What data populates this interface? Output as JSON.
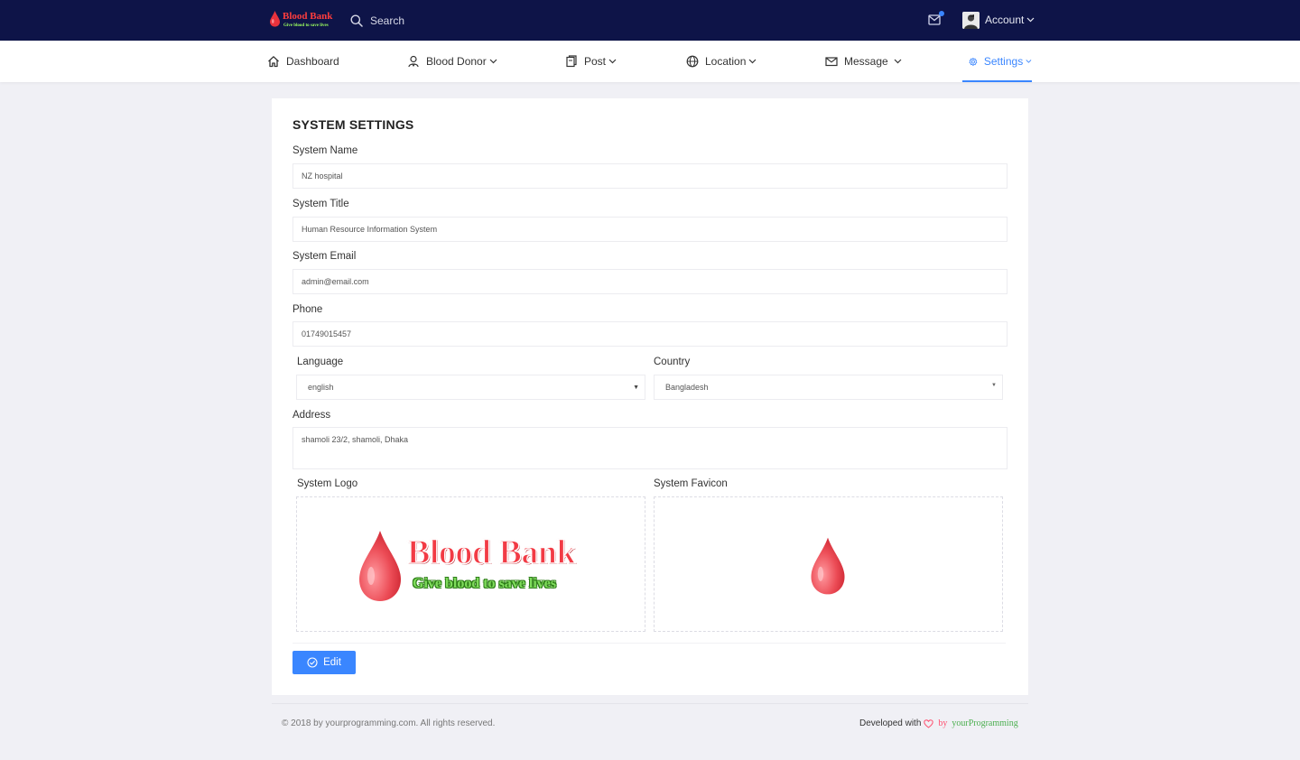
{
  "brand": {
    "title": "Blood Bank",
    "tagline": "Give blood to save lives"
  },
  "topbar": {
    "search_label": "Search",
    "account_label": "Account"
  },
  "nav": {
    "items": [
      {
        "label": "Dashboard",
        "icon": "home-icon"
      },
      {
        "label": "Blood Donor",
        "icon": "donor-icon"
      },
      {
        "label": "Post",
        "icon": "post-icon"
      },
      {
        "label": "Location",
        "icon": "globe-icon"
      },
      {
        "label": "Message",
        "icon": "envelope-icon"
      },
      {
        "label": "Settings",
        "icon": "gear-icon",
        "active": true
      }
    ]
  },
  "settings": {
    "title": "SYSTEM SETTINGS",
    "system_name_label": "System Name",
    "system_name_value": "NZ hospital",
    "system_title_label": "System Title",
    "system_title_value": "Human Resource Information System",
    "system_email_label": "System Email",
    "system_email_value": "admin@email.com",
    "phone_label": "Phone",
    "phone_value": "01749015457",
    "language_label": "Language",
    "language_value": "english",
    "country_label": "Country",
    "country_value": "Bangladesh",
    "address_label": "Address",
    "address_value": "shamoli 23/2, shamoli, Dhaka",
    "logo_label": "System Logo",
    "favicon_label": "System Favicon",
    "edit_label": "Edit"
  },
  "footer": {
    "copyright": "© 2018 by yourprogramming.com. All rights reserved.",
    "developed_with": "Developed with",
    "by": "by",
    "org": "yourProgramming"
  },
  "colors": {
    "topbar": "#0e1448",
    "accent": "#3a86ff",
    "blood": "#f23b45",
    "page_bg": "#f0f0f5"
  }
}
